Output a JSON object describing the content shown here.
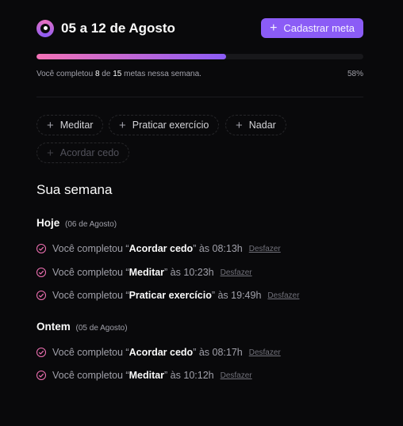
{
  "header": {
    "title": "05 a 12 de Agosto",
    "add_button_label": "Cadastrar meta",
    "add_button_icon": "plus-icon",
    "logo_icon": "target-logo-icon"
  },
  "progress": {
    "completed": "8",
    "total": "15",
    "text_prefix": "Você completou",
    "text_de": "de",
    "text_suffix": "metas nessa semana.",
    "percent_label": "58%",
    "fraction": 0.58
  },
  "pending_goals": [
    {
      "label": "Meditar",
      "disabled": false
    },
    {
      "label": "Praticar exercício",
      "disabled": false
    },
    {
      "label": "Nadar",
      "disabled": false
    },
    {
      "label": "Acordar cedo",
      "disabled": true
    }
  ],
  "summary": {
    "title": "Sua semana",
    "days": [
      {
        "name": "Hoje",
        "date": "(06 de Agosto)",
        "entries": [
          {
            "prefix": "Você completou “",
            "goal": "Acordar cedo",
            "mid": "” às",
            "time": "08:13h",
            "undo": "Desfazer"
          },
          {
            "prefix": "Você completou “",
            "goal": "Meditar",
            "mid": "” às",
            "time": "10:23h",
            "undo": "Desfazer"
          },
          {
            "prefix": "Você completou “",
            "goal": "Praticar exercício",
            "mid": "” às",
            "time": "19:49h",
            "undo": "Desfazer"
          }
        ]
      },
      {
        "name": "Ontem",
        "date": "(05 de Agosto)",
        "entries": [
          {
            "prefix": "Você completou “",
            "goal": "Acordar cedo",
            "mid": "” às",
            "time": "08:17h",
            "undo": "Desfazer"
          },
          {
            "prefix": "Você completou “",
            "goal": "Meditar",
            "mid": "” às",
            "time": "10:12h",
            "undo": "Desfazer"
          }
        ]
      }
    ]
  },
  "colors": {
    "background": "#09090b",
    "accent": "#8b5cf6",
    "pink": "#f472b6"
  }
}
